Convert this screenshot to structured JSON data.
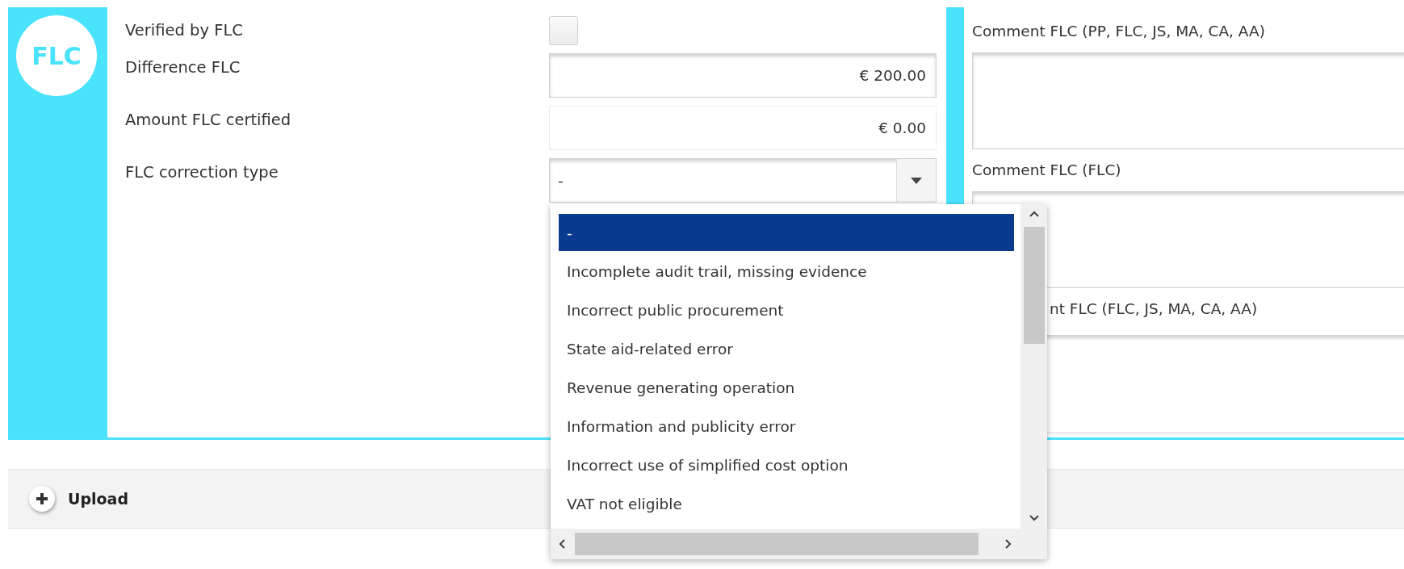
{
  "badge": "FLC",
  "fields": [
    {
      "kind": "checkbox",
      "label": "Verified by FLC",
      "checked": false
    },
    {
      "kind": "amount",
      "label": "Difference FLC",
      "value": "€ 200.00",
      "readonly": false
    },
    {
      "kind": "amount",
      "label": "Amount FLC certified",
      "value": "€ 0.00",
      "readonly": true
    },
    {
      "kind": "select",
      "label": "FLC correction type",
      "value": "-",
      "expanded": true
    }
  ],
  "comments": [
    {
      "label": "Comment FLC (PP, FLC, JS, MA, CA, AA)",
      "covered": false
    },
    {
      "label": "Comment FLC (FLC)",
      "covered": false
    },
    {
      "label": "nt FLC (FLC, JS, MA, CA, AA)",
      "covered": true
    }
  ],
  "dropdown": {
    "options": [
      {
        "label": "-",
        "selected": true
      },
      {
        "label": "Incomplete audit trail, missing evidence",
        "selected": false
      },
      {
        "label": "Incorrect public procurement",
        "selected": false
      },
      {
        "label": "State aid-related error",
        "selected": false
      },
      {
        "label": "Revenue generating operation",
        "selected": false
      },
      {
        "label": "Information and publicity error",
        "selected": false
      },
      {
        "label": "Incorrect use of simplified cost option",
        "selected": false
      },
      {
        "label": "VAT not eligible",
        "selected": false
      }
    ]
  },
  "upload": {
    "label": "Upload"
  }
}
